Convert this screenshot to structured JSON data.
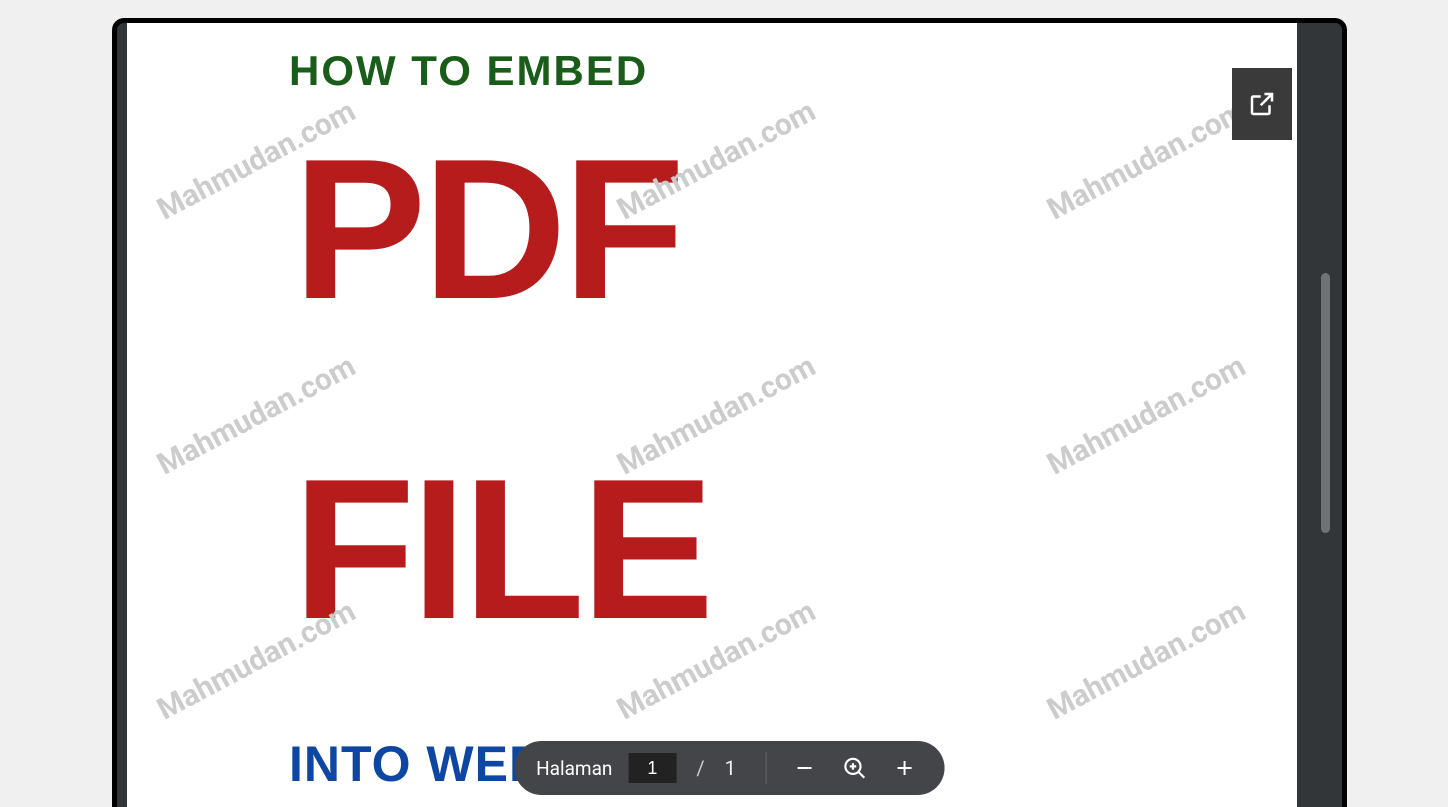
{
  "document": {
    "heading": "HOW TO EMBED",
    "big_line1": "PDF",
    "big_line2": "FILE",
    "subheading": "INTO WEB PAGE"
  },
  "watermark": {
    "text": "Mahmudan.com"
  },
  "viewer": {
    "popout_tooltip": "Open in new tab"
  },
  "toolbar": {
    "page_label": "Halaman",
    "current_page": "1",
    "page_separator": "/",
    "total_pages": "1",
    "zoom_out_tooltip": "Zoom out",
    "zoom_reset_tooltip": "Reset zoom",
    "zoom_in_tooltip": "Zoom in"
  }
}
